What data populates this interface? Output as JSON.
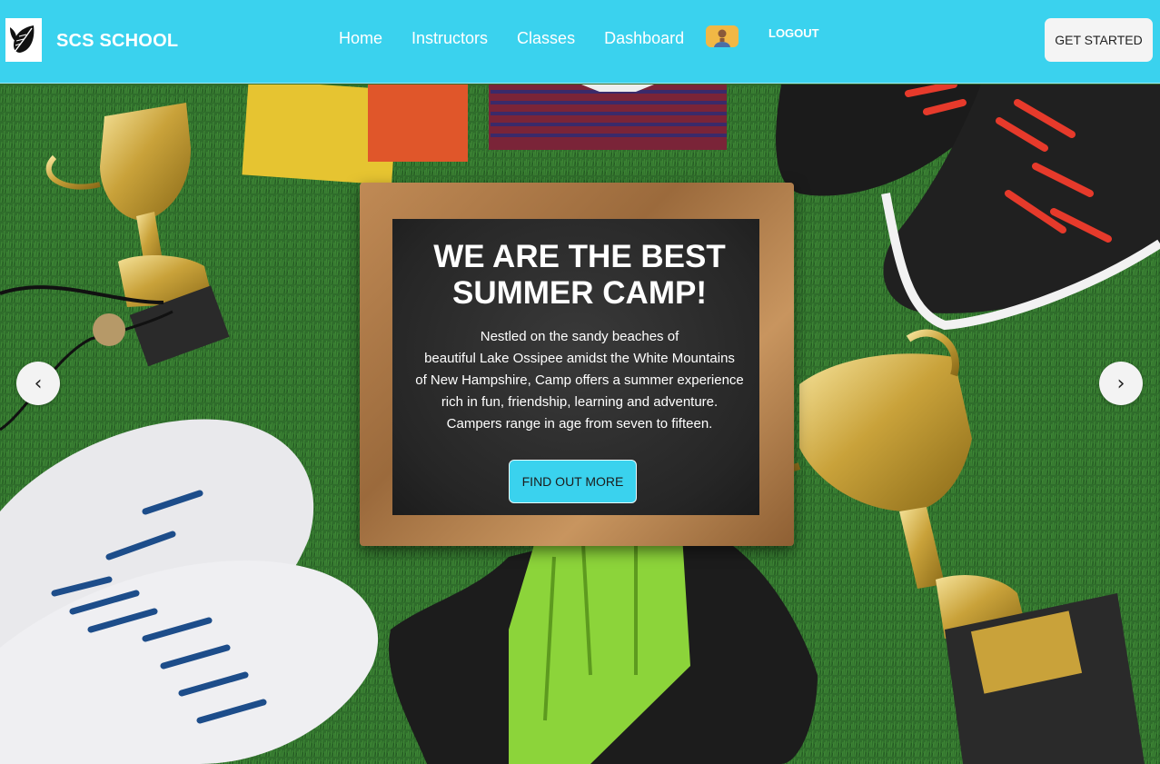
{
  "brand": {
    "name": "SCS SCHOOL",
    "logo_icon": "leaf-logo-icon"
  },
  "nav": {
    "links": [
      {
        "label": "Home"
      },
      {
        "label": "Instructors"
      },
      {
        "label": "Classes"
      },
      {
        "label": "Dashboard"
      }
    ],
    "logout_label": "LOGOUT",
    "cta_label": "GET STARTED"
  },
  "hero": {
    "title_line1": "WE ARE THE BEST",
    "title_line2": "SUMMER CAMP!",
    "text_lines": [
      "Nestled on the sandy beaches of",
      "beautiful Lake Ossipee amidst the White Mountains",
      "of New Hampshire, Camp offers a summer experience",
      "rich in fun, friendship, learning and adventure.",
      "Campers range in age from seven to fifteen."
    ],
    "button_label": "FIND OUT MORE",
    "prev_glyph": "‹",
    "next_glyph": "›"
  },
  "colors": {
    "navbar": "#3ad2ee",
    "accent_button": "#3ad2ee",
    "cta_button": "#f4f4f4"
  }
}
